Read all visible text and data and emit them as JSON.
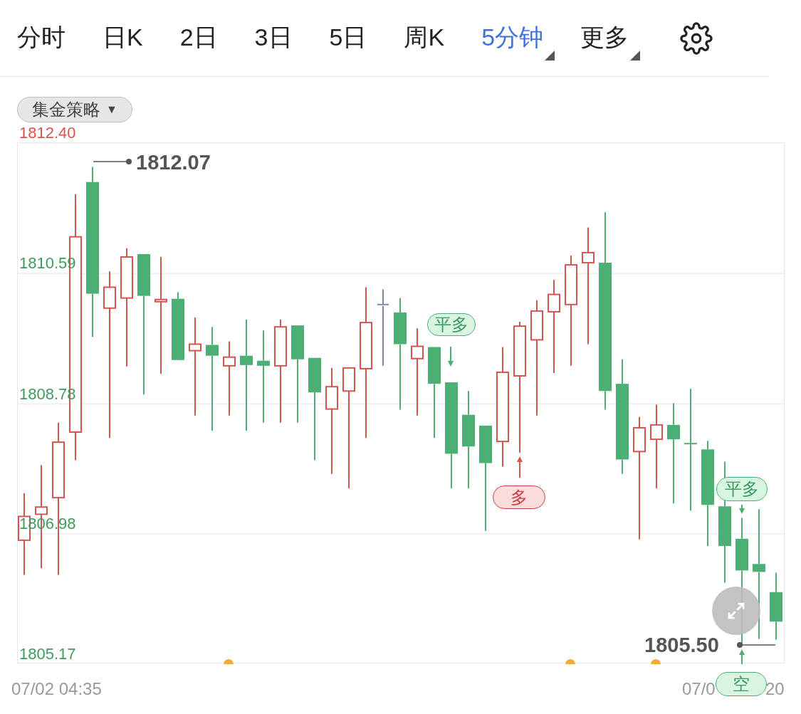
{
  "tabs": [
    {
      "label": "分时",
      "selected": false,
      "dropdown": false
    },
    {
      "label": "日K",
      "selected": false,
      "dropdown": false
    },
    {
      "label": "2日",
      "selected": false,
      "dropdown": false
    },
    {
      "label": "3日",
      "selected": false,
      "dropdown": false
    },
    {
      "label": "5日",
      "selected": false,
      "dropdown": false
    },
    {
      "label": "周K",
      "selected": false,
      "dropdown": false
    },
    {
      "label": "5分钟",
      "selected": true,
      "dropdown": true
    },
    {
      "label": "更多",
      "selected": false,
      "dropdown": true
    }
  ],
  "strategy_chip": {
    "label": "集金策略",
    "caret": "▼"
  },
  "chart": {
    "chart_data": {
      "type": "candlestick",
      "ylim": [
        1805.17,
        1812.4
      ],
      "grid": true,
      "categories": [
        null,
        null,
        null,
        null,
        null,
        null,
        null,
        null,
        null,
        null,
        null,
        null,
        null,
        null,
        null,
        null,
        null,
        null,
        null,
        null,
        null,
        null,
        null,
        null,
        null,
        null,
        null,
        null,
        null,
        null,
        null,
        null,
        null,
        null,
        null,
        null,
        null,
        null,
        null,
        null,
        null,
        null,
        null,
        null,
        null
      ],
      "yticks": [
        {
          "value": 1812.4,
          "label": "1812.40"
        },
        {
          "value": 1810.59,
          "label": "1810.59"
        },
        {
          "value": 1808.78,
          "label": "1808.78"
        },
        {
          "value": 1806.98,
          "label": "1806.98"
        },
        {
          "value": 1805.17,
          "label": "1805.17"
        }
      ],
      "ohlc": [
        [
          1806.89,
          1807.54,
          1806.41,
          1807.22
        ],
        [
          1807.25,
          1807.93,
          1806.5,
          1807.35
        ],
        [
          1807.48,
          1808.52,
          1806.41,
          1808.25
        ],
        [
          1808.39,
          1811.69,
          1808.0,
          1811.1
        ],
        [
          1811.86,
          1812.07,
          1809.71,
          1810.31
        ],
        [
          1810.11,
          1810.62,
          1808.31,
          1810.4
        ],
        [
          1810.25,
          1810.94,
          1809.3,
          1810.82
        ],
        [
          1810.86,
          1810.86,
          1808.91,
          1810.28
        ],
        [
          1810.2,
          1810.82,
          1809.2,
          1810.23
        ],
        [
          1810.24,
          1810.33,
          1809.39,
          1809.39
        ],
        [
          1809.52,
          1809.98,
          1808.62,
          1809.61
        ],
        [
          1809.6,
          1809.85,
          1808.41,
          1809.45
        ],
        [
          1809.31,
          1809.65,
          1808.62,
          1809.43
        ],
        [
          1809.45,
          1809.95,
          1808.41,
          1809.32
        ],
        [
          1809.38,
          1809.8,
          1808.52,
          1809.31
        ],
        [
          1809.31,
          1809.95,
          1808.52,
          1809.85
        ],
        [
          1809.87,
          1809.87,
          1808.52,
          1809.4
        ],
        [
          1809.42,
          1809.42,
          1808.0,
          1808.94
        ],
        [
          1808.71,
          1809.28,
          1807.81,
          1809.02
        ],
        [
          1808.96,
          1809.28,
          1807.61,
          1809.28
        ],
        [
          1809.27,
          1810.4,
          1808.31,
          1809.91
        ],
        [
          1810.16,
          1810.37,
          1809.31,
          1810.16
        ],
        [
          1810.05,
          1810.25,
          1808.7,
          1809.61
        ],
        [
          1809.41,
          1809.83,
          1808.62,
          1809.58
        ],
        [
          1809.57,
          1809.57,
          1808.31,
          1809.06
        ],
        [
          1809.08,
          1809.08,
          1807.61,
          1808.09
        ],
        [
          1808.63,
          1808.96,
          1807.61,
          1808.19
        ],
        [
          1808.48,
          1808.48,
          1807.02,
          1807.96
        ],
        [
          1808.26,
          1809.57,
          1807.91,
          1809.22
        ],
        [
          1809.17,
          1809.92,
          1808.1,
          1809.86
        ],
        [
          1809.67,
          1810.22,
          1808.62,
          1810.07
        ],
        [
          1810.06,
          1810.5,
          1809.21,
          1810.3
        ],
        [
          1810.16,
          1810.84,
          1809.31,
          1810.71
        ],
        [
          1810.74,
          1811.23,
          1809.61,
          1810.88
        ],
        [
          1810.74,
          1811.44,
          1808.7,
          1808.96
        ],
        [
          1809.06,
          1809.4,
          1807.81,
          1808.01
        ],
        [
          1808.12,
          1808.6,
          1806.9,
          1808.45
        ],
        [
          1808.29,
          1808.77,
          1807.61,
          1808.49
        ],
        [
          1808.49,
          1808.79,
          1807.4,
          1808.29
        ],
        [
          1808.24,
          1808.99,
          1807.3,
          1808.22
        ],
        [
          1808.15,
          1808.27,
          1806.81,
          1807.38
        ],
        [
          1807.36,
          1807.98,
          1806.3,
          1806.81
        ],
        [
          1806.91,
          1807.2,
          1805.44,
          1806.47
        ],
        [
          1806.56,
          1807.32,
          1805.52,
          1806.45
        ],
        [
          1806.17,
          1806.44,
          1805.51,
          1805.76
        ]
      ]
    },
    "price_label_colors": [
      {
        "color": "#d9534f"
      },
      {
        "color": "#3f9a5f"
      },
      {
        "color": "#3f9a5f"
      },
      {
        "color": "#3f9a5f"
      },
      {
        "color": "#3f9a5f"
      }
    ],
    "high_label": "1812.07",
    "last_label": "1805.50",
    "signals": [
      {
        "text": "平多",
        "kind": "close"
      },
      {
        "text": "多",
        "kind": "long"
      },
      {
        "text": "平多",
        "kind": "close"
      },
      {
        "text": "空",
        "kind": "short"
      }
    ],
    "time_start": "07/02 04:35",
    "time_end_parts": [
      "07/0",
      "20"
    ]
  }
}
